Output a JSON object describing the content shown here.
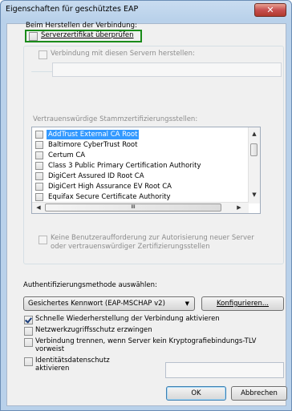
{
  "window": {
    "title": "Eigenschaften für geschütztes EAP",
    "close_glyph": "✕"
  },
  "connect": {
    "heading": "Beim Herstellen der Verbindung:",
    "verify_cert": "Serverzertifikat überprüfen",
    "connect_servers": "Verbindung mit diesen Servern herstellen:",
    "servers_value": ""
  },
  "trusted_ca": {
    "heading": "Vertrauenswürdige Stammzertifizierungsstellen:",
    "items": [
      "AddTrust External CA Root",
      "Baltimore CyberTrust Root",
      "Certum CA",
      "Class 3 Public Primary Certification Authority",
      "DigiCert Assured ID Root CA",
      "DigiCert High Assurance EV Root CA",
      "Equifax Secure Certificate Authority"
    ],
    "selected_index": 0,
    "hscroll_thumb_glyph": "III",
    "no_prompt": "Keine Benutzeraufforderung zur Autorisierung neuer Server oder vertrauenswürdiger Zertifizierungsstellen"
  },
  "auth": {
    "heading": "Authentifizierungsmethode auswählen:",
    "method_selected": "Gesichertes Kennwort (EAP-MSCHAP v2)",
    "configure_button": "Konfigurieren..."
  },
  "options": {
    "fast_reconnect": "Schnelle Wiederherstellung der Verbindung aktivieren",
    "fast_reconnect_checked": true,
    "nap": "Netzwerkzugriffsschutz erzwingen",
    "nap_checked": false,
    "disconnect_tlv": "Verbindung trennen, wenn Server kein Kryptografiebindungs-TLV vorweist",
    "disconnect_tlv_checked": false,
    "identity_privacy": "Identitätsdatenschutz aktivieren",
    "identity_privacy_checked": false,
    "identity_value": ""
  },
  "buttons": {
    "ok": "OK",
    "cancel": "Abbrechen"
  }
}
